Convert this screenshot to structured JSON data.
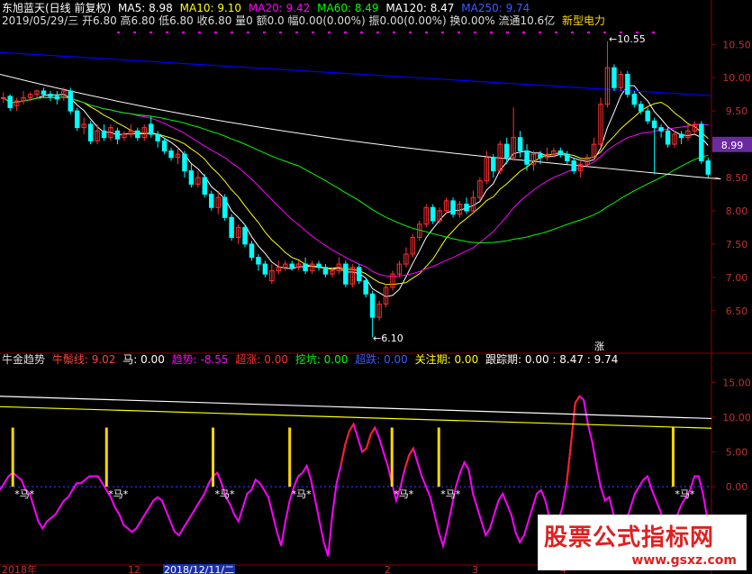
{
  "header": {
    "title": "东旭蓝天(日线 前复权)",
    "ma5": "MA5: 8.98",
    "ma10": "MA10: 9.10",
    "ma20": "MA20: 9.42",
    "ma60": "MA60: 8.49",
    "ma120": "MA120: 8.47",
    "ma250": "MA250: 9.74",
    "date_line": "2019/05/29/三 开6.80 高6.80 低6.80 收6.80 量0 额0.0 幅0.00(0.00%) 振0.00(0.00%) 换0.00% 流通10.6亿",
    "sector": "新型电力"
  },
  "indicator": {
    "name": "牛金趋势",
    "niuzong": "牛鬃线: 9.02",
    "ma": "马: 0.00",
    "trend": "趋势: -8.55",
    "chaozhang": "超涨: 0.00",
    "wakeng": "挖坑: 0.00",
    "chaodie": "超跌: 0.00",
    "guanzhu": "关注期: 0.00",
    "genzong": "跟踪期: 0.00 : 8.47 : 9.74"
  },
  "annotations": {
    "high": "10.55",
    "low": "6.10",
    "zhang": "涨",
    "price_tag": "8.99",
    "ma_marker": "*马*"
  },
  "xaxis_labels": [
    "2018年",
    "12",
    "2018/12/11/二",
    "2",
    "3",
    "4"
  ],
  "watermark": {
    "line1": "股票公式指标网",
    "line2": "www.gsxz.com"
  },
  "colors": {
    "ma5": "#ffffff",
    "ma10": "#ffff00",
    "ma20": "#ff00ff",
    "ma60": "#00ff00",
    "ma120": "#ffffff",
    "ma250": "#0000ff",
    "up": "#ff3030",
    "down": "#00ffff",
    "accent": "#ffd700",
    "grid": "#8b0000"
  },
  "chart_data": [
    {
      "type": "candlestick",
      "yticks": [
        6.5,
        7.0,
        7.5,
        8.0,
        8.5,
        9.0,
        9.5,
        10.0,
        10.5
      ],
      "ylim": [
        6.05,
        10.72
      ],
      "candles": [
        [
          9.7,
          9.7,
          9.62,
          9.78
        ],
        [
          9.72,
          9.55,
          9.5,
          9.75
        ],
        [
          9.58,
          9.65,
          9.5,
          9.7
        ],
        [
          9.65,
          9.7,
          9.6,
          9.8
        ],
        [
          9.7,
          9.75,
          9.65,
          9.78
        ],
        [
          9.75,
          9.8,
          9.7,
          9.82
        ],
        [
          9.8,
          9.75,
          9.7,
          9.85
        ],
        [
          9.75,
          9.72,
          9.65,
          9.8
        ],
        [
          9.72,
          9.68,
          9.6,
          9.8
        ],
        [
          9.7,
          9.8,
          9.65,
          9.85
        ],
        [
          9.8,
          9.5,
          9.45,
          9.85
        ],
        [
          9.5,
          9.25,
          9.2,
          9.55
        ],
        [
          9.25,
          9.3,
          9.15,
          9.4
        ],
        [
          9.3,
          9.05,
          9.0,
          9.35
        ],
        [
          9.05,
          9.2,
          9.0,
          9.3
        ],
        [
          9.2,
          9.1,
          9.05,
          9.3
        ],
        [
          9.1,
          9.25,
          9.05,
          9.3
        ],
        [
          9.2,
          9.08,
          9.0,
          9.25
        ],
        [
          9.1,
          9.15,
          9.05,
          9.2
        ],
        [
          9.15,
          9.2,
          9.1,
          9.3
        ],
        [
          9.2,
          9.1,
          9.05,
          9.25
        ],
        [
          9.1,
          9.25,
          9.05,
          9.3
        ],
        [
          9.3,
          9.15,
          9.1,
          9.42
        ],
        [
          9.15,
          9.05,
          8.95,
          9.2
        ],
        [
          9.05,
          8.9,
          8.85,
          9.1
        ],
        [
          8.9,
          8.8,
          8.75,
          8.95
        ],
        [
          8.8,
          8.85,
          8.7,
          8.95
        ],
        [
          8.85,
          8.6,
          8.5,
          8.9
        ],
        [
          8.6,
          8.4,
          8.35,
          8.7
        ],
        [
          8.4,
          8.5,
          8.35,
          8.6
        ],
        [
          8.5,
          8.25,
          8.2,
          8.55
        ],
        [
          8.25,
          8.05,
          8.0,
          8.3
        ],
        [
          8.05,
          8.2,
          7.95,
          8.3
        ],
        [
          8.2,
          7.9,
          7.85,
          8.25
        ],
        [
          7.9,
          7.6,
          7.55,
          7.95
        ],
        [
          7.6,
          7.75,
          7.5,
          7.8
        ],
        [
          7.75,
          7.5,
          7.45,
          7.8
        ],
        [
          7.5,
          7.3,
          7.25,
          7.55
        ],
        [
          7.3,
          7.2,
          7.1,
          7.35
        ],
        [
          7.2,
          7.05,
          7.0,
          7.25
        ],
        [
          6.95,
          7.1,
          6.9,
          7.2
        ],
        [
          7.1,
          7.15,
          7.05,
          7.25
        ],
        [
          7.15,
          7.2,
          7.1,
          7.25
        ],
        [
          7.2,
          7.15,
          7.1,
          7.25
        ],
        [
          7.15,
          7.2,
          7.1,
          7.25
        ],
        [
          7.2,
          7.1,
          7.05,
          7.3
        ],
        [
          7.1,
          7.2,
          7.05,
          7.25
        ],
        [
          7.2,
          7.15,
          7.1,
          7.25
        ],
        [
          7.15,
          7.05,
          7.0,
          7.2
        ],
        [
          7.05,
          7.1,
          7.0,
          7.15
        ],
        [
          7.1,
          7.2,
          7.05,
          7.3
        ],
        [
          7.2,
          6.9,
          6.85,
          7.25
        ],
        [
          6.9,
          7.15,
          6.85,
          7.2
        ],
        [
          7.15,
          6.95,
          6.9,
          7.2
        ],
        [
          6.95,
          6.75,
          6.7,
          7.0
        ],
        [
          6.75,
          6.4,
          6.1,
          6.8
        ],
        [
          6.4,
          6.6,
          6.35,
          6.65
        ],
        [
          6.6,
          6.85,
          6.55,
          6.9
        ],
        [
          6.85,
          7.05,
          6.8,
          7.1
        ],
        [
          7.05,
          7.2,
          7.0,
          7.25
        ],
        [
          7.2,
          7.35,
          7.15,
          7.45
        ],
        [
          7.35,
          7.6,
          7.3,
          7.65
        ],
        [
          7.6,
          7.8,
          7.55,
          7.85
        ],
        [
          7.8,
          8.05,
          7.75,
          8.1
        ],
        [
          8.05,
          7.85,
          7.8,
          8.1
        ],
        [
          7.85,
          8.0,
          7.8,
          8.05
        ],
        [
          8.0,
          8.15,
          7.95,
          8.2
        ],
        [
          8.15,
          7.95,
          7.9,
          8.2
        ],
        [
          7.95,
          8.1,
          7.9,
          8.15
        ],
        [
          8.1,
          8.0,
          7.95,
          8.2
        ],
        [
          8.0,
          8.2,
          7.95,
          8.3
        ],
        [
          8.2,
          8.45,
          8.15,
          8.5
        ],
        [
          8.45,
          8.8,
          8.4,
          8.9
        ],
        [
          8.8,
          8.6,
          8.5,
          8.85
        ],
        [
          8.6,
          9.0,
          8.55,
          9.05
        ],
        [
          9.0,
          8.8,
          8.7,
          9.1
        ],
        [
          8.8,
          9.1,
          8.75,
          9.55
        ],
        [
          9.1,
          8.9,
          8.8,
          9.2
        ],
        [
          8.9,
          8.7,
          8.6,
          9.0
        ],
        [
          8.7,
          8.85,
          8.6,
          8.9
        ],
        [
          8.85,
          8.8,
          8.7,
          8.9
        ],
        [
          8.8,
          8.85,
          8.75,
          8.95
        ],
        [
          8.85,
          8.9,
          8.8,
          8.95
        ],
        [
          8.9,
          8.85,
          8.8,
          8.95
        ],
        [
          8.85,
          8.75,
          8.7,
          8.9
        ],
        [
          8.75,
          8.6,
          8.55,
          8.8
        ],
        [
          8.6,
          8.7,
          8.5,
          8.75
        ],
        [
          8.7,
          8.8,
          8.65,
          8.85
        ],
        [
          8.8,
          9.0,
          8.75,
          9.1
        ],
        [
          9.0,
          9.6,
          8.95,
          9.7
        ],
        [
          9.6,
          10.15,
          9.55,
          10.55
        ],
        [
          10.15,
          9.85,
          9.8,
          10.2
        ],
        [
          9.85,
          10.05,
          9.8,
          10.1
        ],
        [
          10.05,
          9.75,
          9.7,
          10.1
        ],
        [
          9.75,
          9.6,
          9.55,
          9.8
        ],
        [
          9.6,
          9.5,
          9.45,
          9.65
        ],
        [
          9.5,
          9.35,
          9.3,
          9.55
        ],
        [
          9.35,
          9.25,
          8.55,
          9.4
        ],
        [
          9.25,
          9.2,
          9.1,
          9.3
        ],
        [
          9.2,
          9.0,
          8.95,
          9.25
        ],
        [
          9.0,
          9.15,
          8.95,
          9.2
        ],
        [
          9.15,
          9.1,
          9.0,
          9.2
        ],
        [
          9.1,
          9.2,
          9.05,
          9.3
        ],
        [
          9.2,
          9.3,
          9.15,
          9.35
        ],
        [
          9.3,
          8.75,
          8.7,
          9.35
        ],
        [
          8.75,
          8.55,
          8.5,
          8.8
        ]
      ]
    },
    {
      "type": "line",
      "yticks": [
        0.0,
        5.0,
        10.0,
        15.0
      ],
      "ylim": [
        -11,
        17.5
      ],
      "series": [
        {
          "name": "牛鬃线",
          "values": [
            -0.5,
            0.5,
            1.5,
            2.0,
            1.5,
            1.0,
            -0.5,
            -1.0,
            -3.0,
            -5.0,
            -6.0,
            -5.0,
            -4.5,
            -4.0,
            -3.0,
            -2.0,
            -1.5,
            -0.5,
            0.5,
            0.5,
            1.0,
            1.5,
            1.5,
            1.5,
            0.5,
            -0.5,
            -1.5,
            -3.0,
            -4.0,
            -5.5,
            -6.0,
            -6.5,
            -6.0,
            -5.0,
            -4.0,
            -3.0,
            -2.0,
            -1.5,
            -2.0,
            -3.5,
            -5.0,
            -6.5,
            -7.0,
            -6.0,
            -5.0,
            -4.0,
            -3.0,
            -2.0,
            -1.0,
            0.5,
            1.5,
            2.0,
            0.5,
            -1.5,
            -2.5,
            -4.0,
            -5.0,
            -3.0,
            -1.0,
            -0.5,
            1.0,
            0.5,
            -0.5,
            -1.5,
            -4.0,
            -6.5,
            -8.5,
            -5.0,
            -2.0,
            0.0,
            1.5,
            2.0,
            3.0,
            1.0,
            -2.0,
            -5.0,
            -8.0,
            -10.0,
            -4.0,
            0.5,
            3.0,
            6.0,
            8.0,
            9.0,
            7.0,
            5.0,
            5.5,
            7.5,
            8.5,
            7.0,
            5.0,
            3.0,
            0.5,
            -2.0,
            0.0,
            2.5,
            4.5,
            5.5,
            3.5,
            1.5,
            0.0,
            -1.5,
            -4.0,
            -6.5,
            -8.5,
            -6.0,
            -3.0,
            0.0,
            2.0,
            3.5,
            2.5,
            -1.0,
            -3.0,
            -5.0,
            -7.0,
            -6.0,
            -4.0,
            -2.0,
            -1.0,
            -2.5,
            -4.0,
            -6.5,
            -8.0,
            -7.0,
            -5.0,
            -3.0,
            -1.0,
            -0.5,
            -2.0,
            -4.5,
            -7.0,
            -5.0,
            -3.0,
            0.5,
            6.0,
            12.0,
            13.0,
            12.5,
            9.0,
            6.5,
            3.0,
            0.0,
            -2.0,
            -1.5,
            -4.0,
            -6.0,
            -7.5,
            -5.0,
            -3.0,
            -1.0,
            0.0,
            1.0,
            1.5,
            -0.5,
            -2.0,
            -3.5,
            -6.0,
            -7.0,
            -6.0,
            -4.0,
            -2.5,
            -1.5,
            -0.5,
            1.5,
            1.5,
            -1.0,
            -4.5,
            -8.55
          ]
        },
        {
          "name": "马",
          "values": [
            0,
            0,
            0,
            0,
            0,
            0,
            0,
            0,
            0,
            0,
            0,
            0,
            0,
            0,
            0,
            0,
            0,
            0,
            0,
            0,
            0,
            0,
            0,
            0,
            0,
            0,
            0,
            0,
            0,
            0,
            0,
            0,
            0,
            0,
            0,
            0,
            0,
            0,
            0,
            0,
            0,
            0,
            0,
            0,
            0,
            0,
            0,
            0,
            0,
            0,
            0,
            0,
            0,
            0,
            0,
            0,
            0,
            0,
            0,
            0,
            0,
            0,
            0,
            0,
            0,
            0,
            0,
            0,
            0,
            0,
            0,
            0,
            0,
            0,
            0,
            0,
            0,
            0,
            0,
            0,
            0,
            0,
            0,
            0,
            0,
            0,
            0,
            0,
            0,
            0,
            0,
            0,
            0,
            0,
            0,
            0,
            0,
            0,
            0,
            0,
            0,
            0,
            0,
            0,
            0,
            0,
            0,
            0,
            0,
            0,
            0,
            0,
            0,
            0,
            0,
            0,
            0,
            0,
            0,
            0,
            0,
            0,
            0,
            0,
            0,
            0,
            0,
            0,
            0,
            0,
            0,
            0,
            0,
            0,
            0,
            0,
            0,
            0,
            0,
            0,
            0,
            0,
            0,
            0,
            0,
            0,
            0,
            0,
            0,
            0,
            0,
            0,
            0,
            0,
            0,
            0,
            0,
            0,
            0,
            0,
            0,
            0,
            0,
            0,
            0,
            0,
            0,
            0,
            0,
            0,
            0,
            0,
            0,
            0
          ]
        }
      ],
      "ref_lines": [
        [
          13.0,
          9.8
        ],
        [
          11.5,
          8.4
        ]
      ],
      "signals": [
        3,
        25,
        50,
        68,
        92,
        103,
        158,
        183
      ],
      "signal_level": 8.5
    }
  ]
}
